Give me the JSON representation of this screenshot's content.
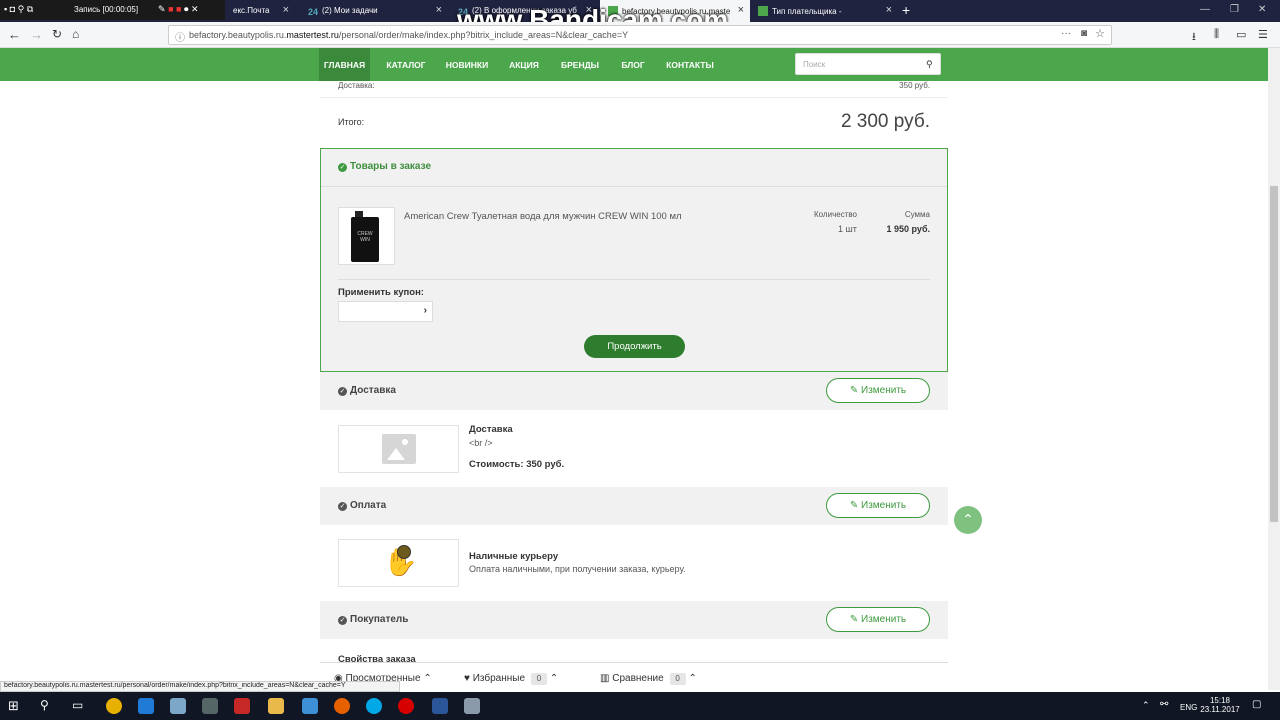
{
  "recorder": {
    "label": "Запись [00:00:05]"
  },
  "watermark": "www.Bandicam.com",
  "tabs": [
    {
      "label": "екс.Почта"
    },
    {
      "label": "(2) Мои задачи"
    },
    {
      "label": "(2) В оформлении заказа уб"
    },
    {
      "label": "befactory.beautypolis.ru.maste"
    },
    {
      "label": "Тип плательщика -"
    }
  ],
  "address": {
    "prefix": "befactory.beautypolis.ru.",
    "domain": "mastertest.ru",
    "path": "/personal/order/make/index.php?bitrix_include_areas=N&clear_cache=Y"
  },
  "menu": {
    "items": [
      "ГЛАВНАЯ",
      "КАТАЛОГ",
      "НОВИНКИ",
      "АКЦИЯ",
      "БРЕНДЫ",
      "БЛОГ",
      "КОНТАКТЫ"
    ],
    "search_placeholder": "Поиск"
  },
  "summary": {
    "delivery_label": "Доставка:",
    "delivery_value": "350 руб.",
    "total_label": "Итого:",
    "total_value": "2 300 руб."
  },
  "goods": {
    "title": "Товары в заказе",
    "product_name": "American Crew Туалетная вода для мужчин CREW WIN 100 мл",
    "qty_label": "Количество",
    "qty_value": "1 шт",
    "sum_label": "Сумма",
    "sum_value": "1 950 руб.",
    "coupon_label": "Применить купон:",
    "continue_label": "Продолжить"
  },
  "delivery": {
    "title": "Доставка",
    "edit_label": "Изменить",
    "name": "Доставка",
    "desc": "<br />",
    "cost": "Стоимость: 350 руб."
  },
  "payment": {
    "title": "Оплата",
    "edit_label": "Изменить",
    "name": "Наличные курьеру",
    "desc": "Оплата наличными, при получении заказа, курьеру."
  },
  "buyer": {
    "title": "Покупатель",
    "edit_label": "Изменить",
    "props_label": "Свойства заказа"
  },
  "bottom_panel": {
    "viewed_label": "Просмотренные",
    "favorites_label": "Избранные",
    "favorites_count": "0",
    "compare_label": "Сравнение",
    "compare_count": "0"
  },
  "status_url": "befactory.beautypolis.ru.mastertest.ru/personal/order/make/index.php?bitrix_include_areas=N&clear_cache=Y",
  "taskbar": {
    "lang": "ENG",
    "time": "15:18",
    "date": "23.11.2017"
  },
  "colors": {
    "brand_green": "#4ca64c",
    "accent_green": "#3e9a3e"
  }
}
